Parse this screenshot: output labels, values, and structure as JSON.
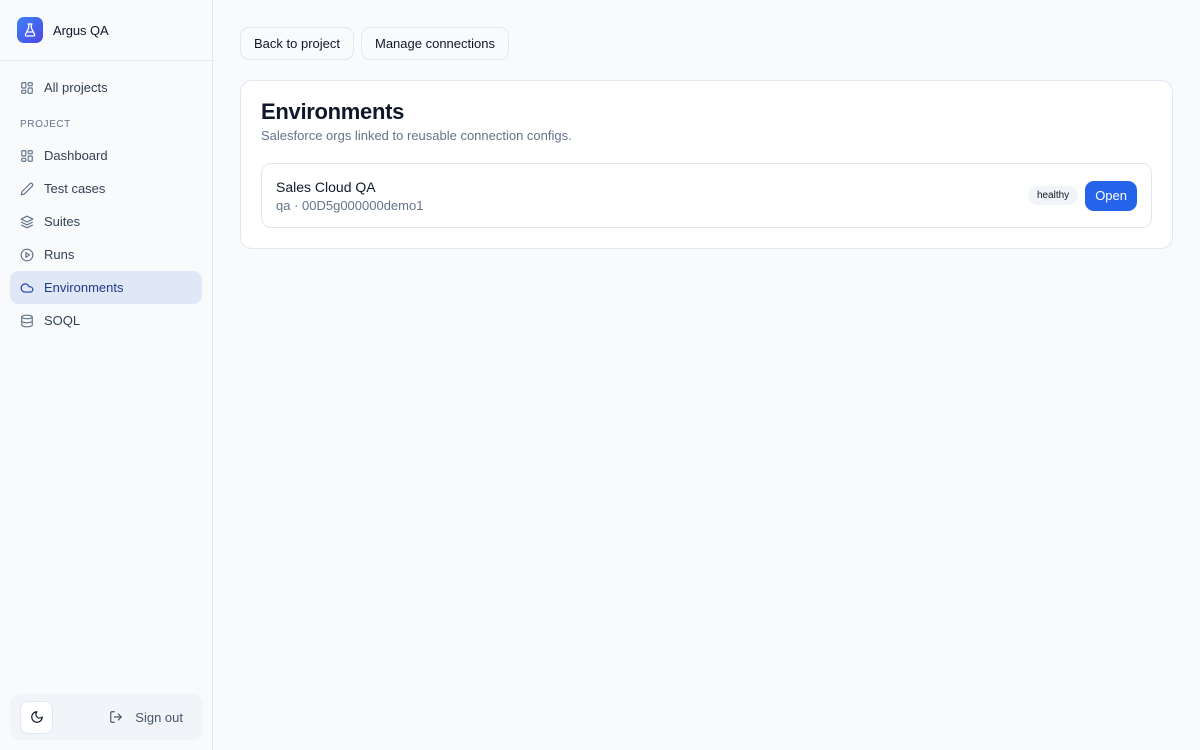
{
  "brand": {
    "name": "Argus QA",
    "logo_icon": "flask-icon"
  },
  "sidebar": {
    "all_projects": {
      "label": "All projects",
      "icon": "grid-icon"
    },
    "section_label": "PROJECT",
    "items": [
      {
        "label": "Dashboard",
        "icon": "grid-icon",
        "active": false
      },
      {
        "label": "Test cases",
        "icon": "pencil-icon",
        "active": false
      },
      {
        "label": "Suites",
        "icon": "layers-icon",
        "active": false
      },
      {
        "label": "Runs",
        "icon": "play-circle-icon",
        "active": false
      },
      {
        "label": "Environments",
        "icon": "cloud-icon",
        "active": true
      },
      {
        "label": "SOQL",
        "icon": "database-icon",
        "active": false
      }
    ],
    "footer": {
      "theme_icon": "moon-icon",
      "sign_out_label": "Sign out",
      "sign_out_icon": "log-out-icon"
    }
  },
  "toolbar": {
    "back_label": "Back to project",
    "manage_label": "Manage connections"
  },
  "environments": {
    "title": "Environments",
    "subtitle": "Salesforce orgs linked to reusable connection configs.",
    "rows": [
      {
        "name": "Sales Cloud QA",
        "meta": "qa · 00D5g000000demo1",
        "status": "healthy",
        "open_label": "Open"
      }
    ]
  },
  "colors": {
    "accent": "#2563eb",
    "active_nav_bg": "#e0e8f7",
    "badge_bg": "#f1f5f9"
  }
}
